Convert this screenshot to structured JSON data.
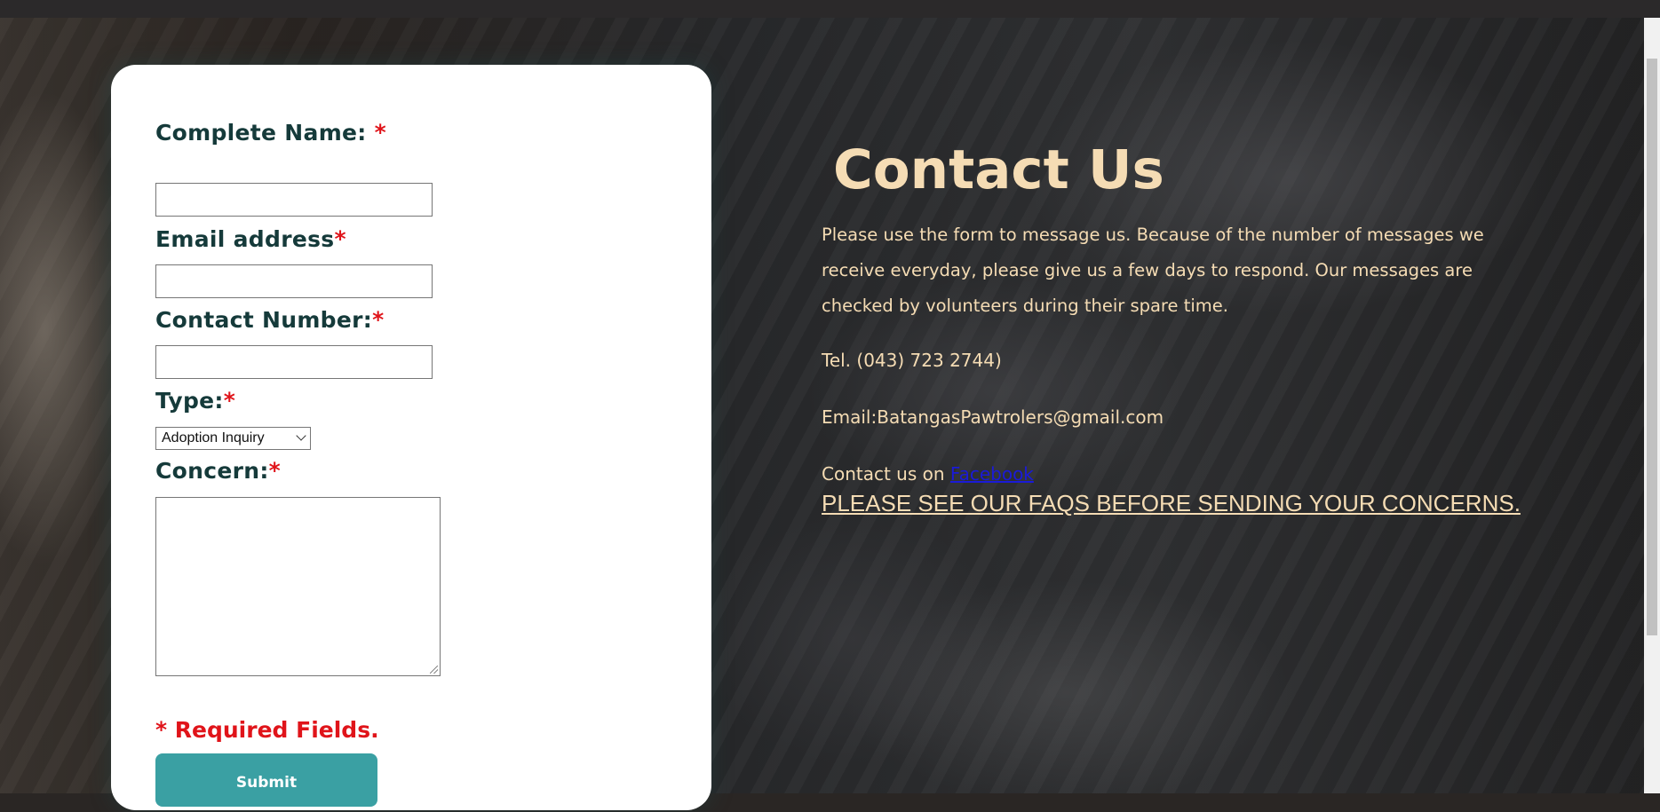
{
  "form": {
    "name_label": "Complete Name: ",
    "email_label": "Email address",
    "contact_label": "Contact Number:",
    "type_label": "Type:",
    "concern_label": "Concern:",
    "required_mark": "*",
    "type_selected": "Adoption Inquiry",
    "required_note": "* Required Fields.",
    "submit_label": "Submit"
  },
  "contact": {
    "title": "Contact Us",
    "paragraph": "Please use the form to message us. Because of the number of messages we receive everyday, please give us a few days to respond. Our messages are checked by volunteers during their spare time.",
    "tel": "Tel. (043) 723 2744)",
    "email": "Email:BatangasPawtrolers@gmail.com",
    "facebook_prefix": "Contact us on ",
    "facebook_link": "Facebook",
    "faq": "PLEASE SEE OUR FAQS BEFORE SENDING YOUR CONCERNS."
  },
  "colors": {
    "accent_text": "#f5dcb4",
    "required_red": "#e0141a",
    "label_dark": "#153a3a",
    "submit_teal": "#3aa0a3",
    "link_blue": "#1a1ad8"
  },
  "icons": {
    "select_arrow": "chevron-down-icon",
    "resize_grip": "resize-grip-icon"
  }
}
